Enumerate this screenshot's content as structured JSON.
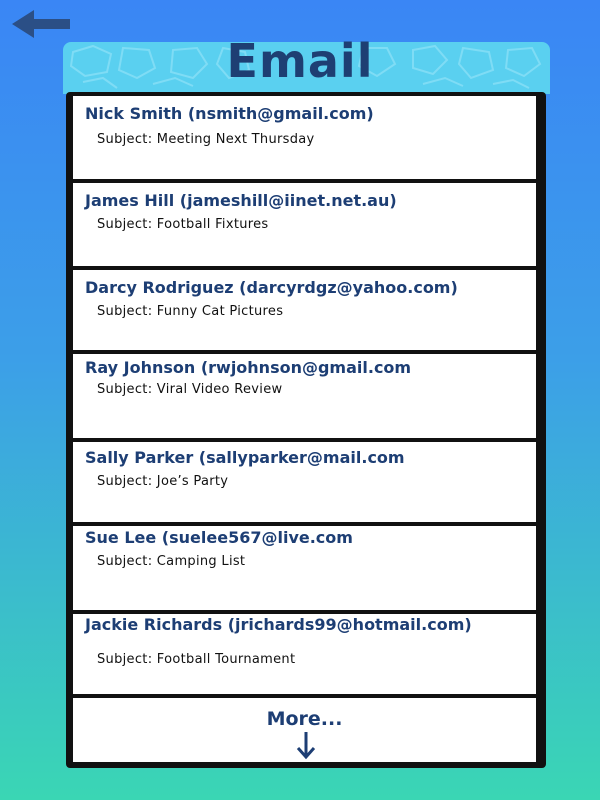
{
  "header": {
    "title": "Email",
    "back_icon": "arrow-left-icon"
  },
  "emails": [
    {
      "sender": "Nick Smith (nsmith@gmail.com)",
      "subject": "Subject: Meeting Next Thursday"
    },
    {
      "sender": "James Hill (jameshill@iinet.net.au)",
      "subject": "Subject: Football Fixtures"
    },
    {
      "sender": "Darcy Rodriguez (darcyrdgz@yahoo.com)",
      "subject": "Subject: Funny Cat Pictures"
    },
    {
      "sender": "Ray Johnson (rwjohnson@gmail.com",
      "subject": "Subject: Viral Video Review"
    },
    {
      "sender": "Sally Parker (sallyparker@mail.com",
      "subject": "Subject: Joe’s Party"
    },
    {
      "sender": "Sue Lee (suelee567@live.com",
      "subject": "Subject: Camping List"
    },
    {
      "sender": "Jackie Richards (jrichards99@hotmail.com)",
      "subject": "Subject: Football Tournament"
    }
  ],
  "more": {
    "label": "More...",
    "icon": "arrow-down-icon"
  },
  "colors": {
    "title": "#1e3f73",
    "sender": "#1d3e74",
    "header_band": "#5ad0f0",
    "background_top": "#3a86f5",
    "background_bottom": "#3ad6b4"
  }
}
